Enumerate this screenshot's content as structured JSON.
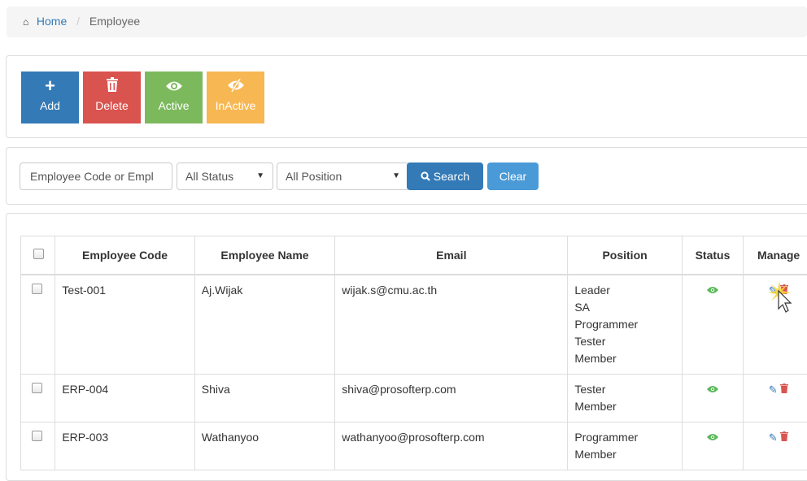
{
  "breadcrumb": {
    "home_icon": "home-icon",
    "home_label": "Home",
    "separator": "/",
    "current": "Employee"
  },
  "toolbar": {
    "add": {
      "label": "Add",
      "icon": "plus-icon",
      "color": "#337ab7"
    },
    "delete": {
      "label": "Delete",
      "icon": "trash-icon",
      "color": "#d9534f"
    },
    "active": {
      "label": "Active",
      "icon": "eye-icon",
      "color": "#7cb95d"
    },
    "inactive": {
      "label": "InActive",
      "icon": "eye-slash-icon",
      "color": "#f7b752"
    }
  },
  "search": {
    "placeholder": "Employee Code or Empl",
    "status_selected": "All Status",
    "position_selected": "All Position",
    "search_label": "Search",
    "clear_label": "Clear"
  },
  "table": {
    "headers": {
      "code": "Employee Code",
      "name": "Employee Name",
      "email": "Email",
      "position": "Position",
      "status": "Status",
      "manage": "Manage"
    },
    "rows": [
      {
        "code": "Test-001",
        "name": "Aj.Wijak",
        "email": "wijak.s@cmu.ac.th",
        "positions": [
          "Leader",
          "SA",
          "Programmer",
          "Tester",
          "Member"
        ],
        "status_icon": "eye-icon"
      },
      {
        "code": "ERP-004",
        "name": "Shiva",
        "email": "shiva@prosofterp.com",
        "positions": [
          "Tester",
          "Member"
        ],
        "status_icon": "eye-icon"
      },
      {
        "code": "ERP-003",
        "name": "Wathanyoo",
        "email": "wathanyoo@prosofterp.com",
        "positions": [
          "Programmer",
          "Member"
        ],
        "status_icon": "eye-icon"
      }
    ]
  },
  "colors": {
    "primary": "#337ab7",
    "danger": "#d9534f",
    "success": "#5cb85c",
    "warning": "#f7b752"
  }
}
